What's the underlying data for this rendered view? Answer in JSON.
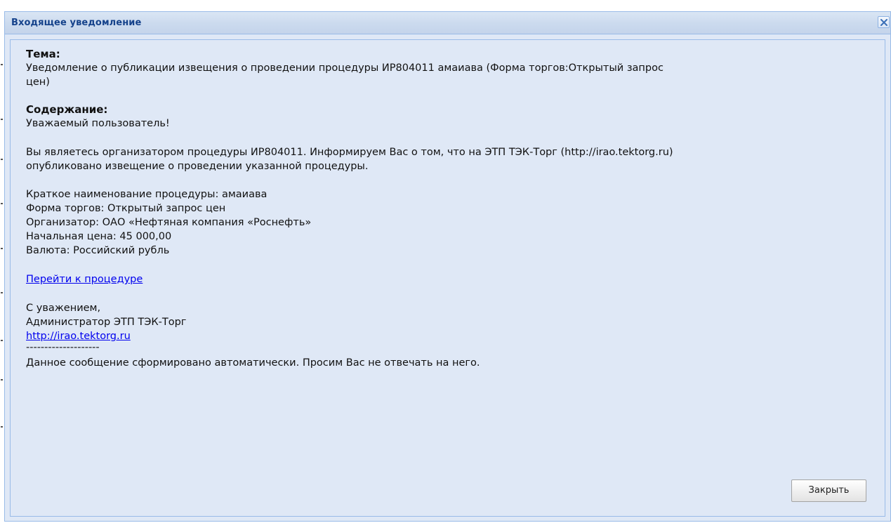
{
  "window": {
    "title": "Входящее уведомление"
  },
  "message": {
    "subject_label": "Тема:",
    "subject_lines": [
      "Уведомление о публикации извещения о проведении процедуры ИР804011 амаиава (Форма торгов:Открытый запрос",
      "цен)"
    ],
    "content_label": "Содержание:",
    "greeting": "Уважаемый пользователь!",
    "info_lines": [
      "Вы являетесь организатором процедуры ИР804011. Информируем Вас о том, что на ЭТП ТЭК-Торг (http://irao.tektorg.ru)",
      "опубликовано извещение о проведении указанной процедуры."
    ],
    "details": [
      "Краткое наименование процедуры: амаиава",
      "Форма торгов: Открытый запрос цен",
      "Организатор: ОАО «Нефтяная компания «Роснефть»",
      "Начальная цена: 45 000,00",
      "Валюта: Российский рубль"
    ],
    "procedure_link": "Перейти к процедуре",
    "regards": "С уважением,",
    "signature": "Администратор ЭТП ТЭК-Торг",
    "site_link": "http://irao.tektorg.ru",
    "separator": "--------------------",
    "footer_note": "Данное сообщение сформировано автоматически. Просим Вас не отвечать на него."
  },
  "buttons": {
    "close_label": "Закрыть"
  },
  "icons": {
    "close": "close-icon"
  },
  "colors": {
    "title_text": "#15428b",
    "window_bg": "#dfe8f6",
    "border": "#99bbe8",
    "link": "#0000ee"
  }
}
